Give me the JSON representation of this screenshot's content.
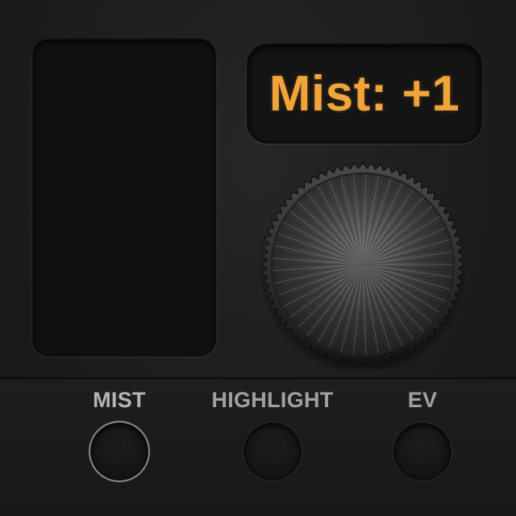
{
  "display": {
    "text": "Mist: +1",
    "color": "#f0a43a"
  },
  "controls": [
    {
      "label": "MIST",
      "active": true
    },
    {
      "label": "HIGHLIGHT",
      "active": false
    },
    {
      "label": "EV",
      "active": false
    }
  ]
}
